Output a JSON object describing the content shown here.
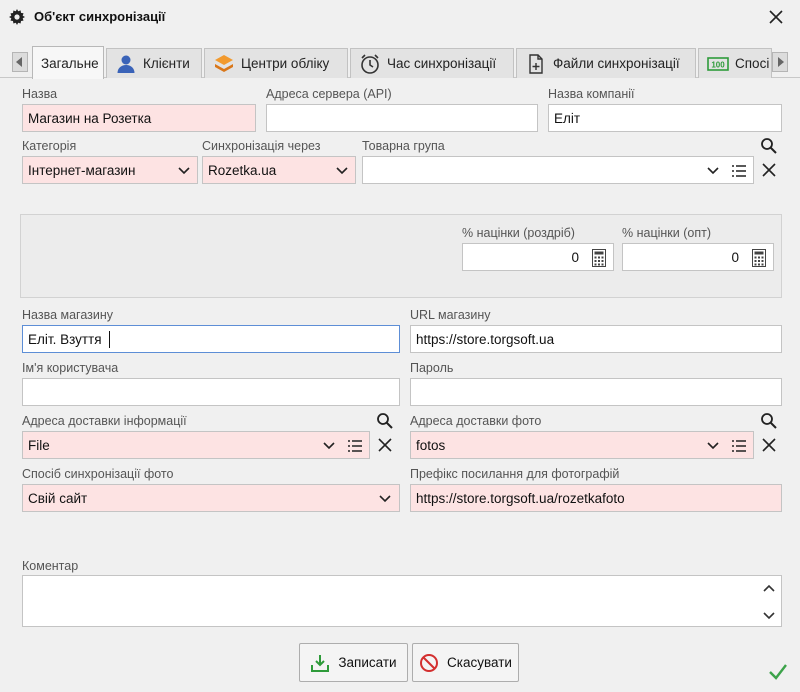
{
  "window": {
    "title": "Об'єкт синхронізації"
  },
  "tabs": [
    {
      "label": "Загальне",
      "icon": "none",
      "active": true
    },
    {
      "label": "Клієнти",
      "icon": "user-icon"
    },
    {
      "label": "Центри обліку",
      "icon": "layers-icon"
    },
    {
      "label": "Час синхронізації",
      "icon": "clock-icon"
    },
    {
      "label": "Файли синхронізації",
      "icon": "add-file-icon"
    },
    {
      "label": "Спосі",
      "icon": "counter-icon"
    }
  ],
  "form": {
    "name": {
      "label": "Назва",
      "value": "Магазин на Розетка"
    },
    "server_address": {
      "label": "Адреса сервера (API)",
      "value": ""
    },
    "company_name": {
      "label": "Назва компанії",
      "value": "Еліт"
    },
    "category": {
      "label": "Категорія",
      "value": "Інтернет-магазин"
    },
    "sync_via": {
      "label": "Синхронізація через",
      "value": "Rozetka.ua"
    },
    "product_group": {
      "label": "Товарна група",
      "value": ""
    },
    "markup_retail": {
      "label": "% націнки (роздріб)",
      "value": "0"
    },
    "markup_wholesale": {
      "label": "% націнки (опт)",
      "value": "0"
    },
    "shop_name": {
      "label": "Назва магазину",
      "value": "Еліт. Взуття"
    },
    "shop_url": {
      "label": "URL магазину",
      "value": "https://store.torgsoft.ua"
    },
    "username": {
      "label": "Ім'я користувача",
      "value": ""
    },
    "password": {
      "label": "Пароль",
      "value": ""
    },
    "info_delivery": {
      "label": "Адреса доставки інформації",
      "value": "File"
    },
    "photo_delivery": {
      "label": "Адреса доставки фото",
      "value": "fotos"
    },
    "photo_sync_method": {
      "label": "Спосіб синхронізації фото",
      "value": "Свій сайт"
    },
    "photo_link_prefix": {
      "label": "Префікс посилання для фотографій",
      "value": "https://store.torgsoft.ua/rozetkafoto"
    },
    "comment": {
      "label": "Коментар",
      "value": ""
    }
  },
  "buttons": {
    "save": "Записати",
    "cancel": "Скасувати"
  },
  "colors": {
    "required_bg": "#fde3e3",
    "focus_border": "#5d8ed6",
    "save_icon": "#2e9b3a",
    "cancel_icon": "#d32f2f"
  }
}
